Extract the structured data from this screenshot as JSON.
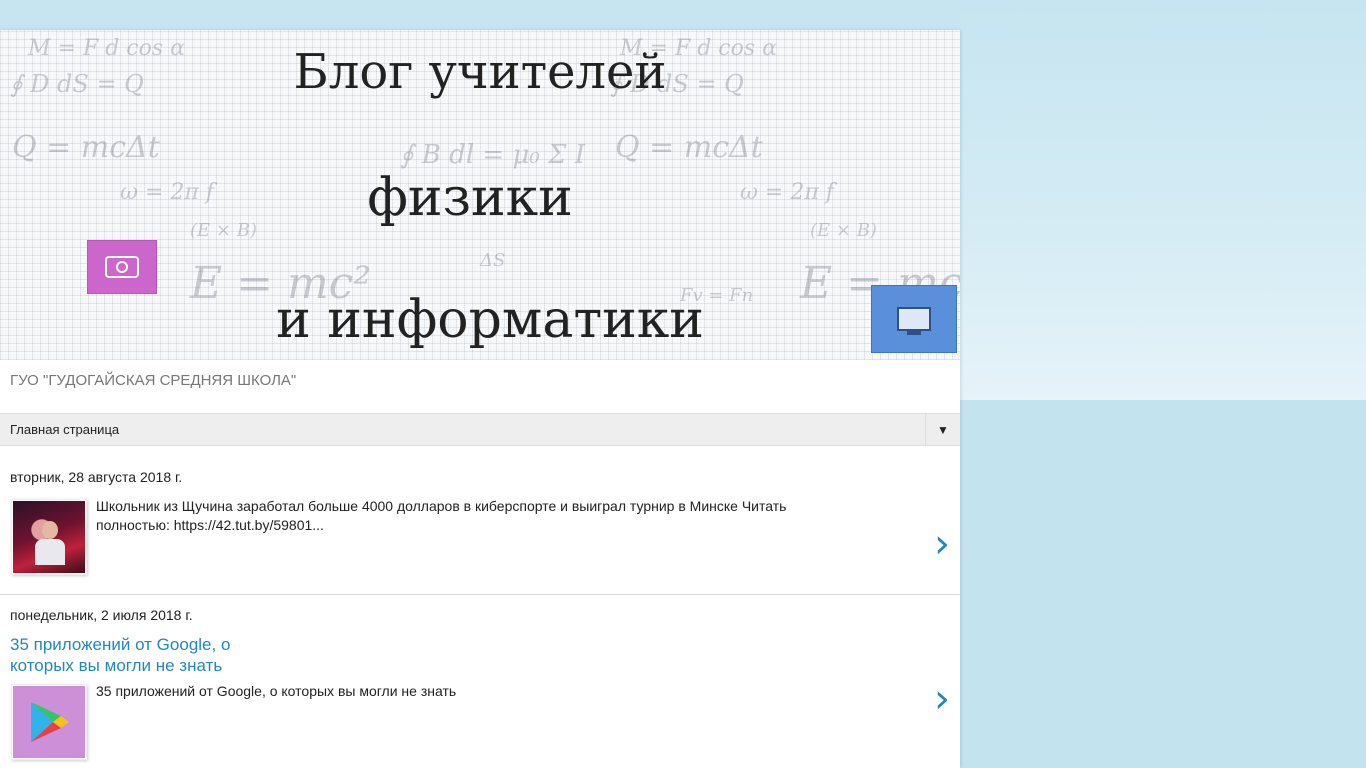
{
  "header": {
    "banner_line1": "Блог учителей",
    "banner_line2": "физики",
    "banner_line3": "и информатики",
    "description": "ГУО \"ГУДОГАЙСКАЯ СРЕДНЯЯ ШКОЛА\""
  },
  "nav": {
    "selected": "Главная страница"
  },
  "posts": [
    {
      "date": "вторник, 28 августа 2018 г.",
      "title": "",
      "snippet": "Школьник из Щучина заработал больше 4000 долларов в киберспорте и выиграл турнир в Минске Читать полностью:  https://42.tut.by/59801...",
      "thumb": "gamer-photo"
    },
    {
      "date": "понедельник, 2 июля 2018 г.",
      "title": "35 приложений от Google, о которых вы могли не знать",
      "snippet": "35 приложений от Google, о которых вы могли не знать",
      "thumb": "google-play-icon"
    }
  ],
  "colors": {
    "page_background": "#c3e3ef",
    "link": "#2288bb",
    "camera_tile": "#cc66cc",
    "pc_tile": "#5a8fdc",
    "play_thumb_background": "#cc8fd8"
  }
}
